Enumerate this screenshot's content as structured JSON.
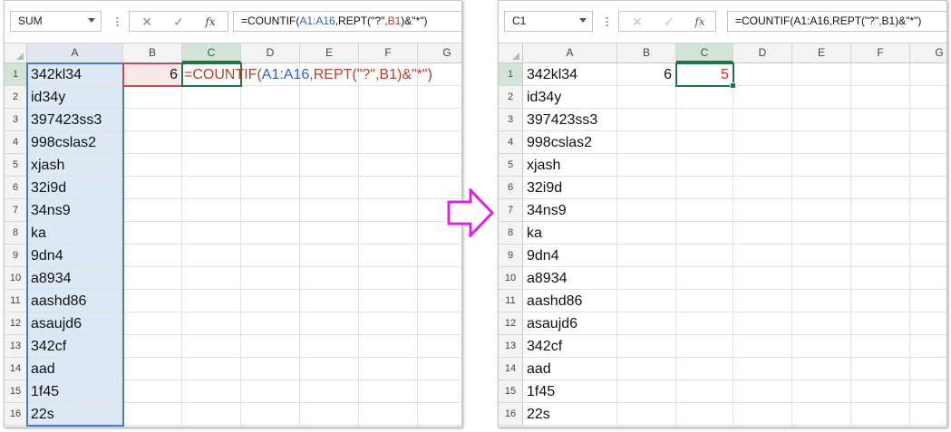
{
  "left": {
    "name_box": "SUM",
    "fx_label": "fx",
    "formula_parts": [
      "=COUNTIF(",
      "A1:A16",
      ",REPT(\"?\",",
      "B1",
      ")&\"*\")"
    ],
    "columns": [
      "A",
      "B",
      "C",
      "D",
      "E",
      "F",
      "G"
    ],
    "b1_value": "6",
    "c1_parts": [
      "=COUNTIF(",
      "A1:A16",
      ",REPT(\"?\",",
      "B1",
      ")&\"*\")"
    ]
  },
  "right": {
    "name_box": "C1",
    "fx_label": "fx",
    "formula": "=COUNTIF(A1:A16,REPT(\"?\",B1)&\"*\")",
    "columns": [
      "A",
      "B",
      "C",
      "D",
      "E",
      "F",
      "G"
    ],
    "b1_value": "6",
    "c1_value": "5"
  },
  "rows": [
    {
      "n": "1",
      "a": "342kl34"
    },
    {
      "n": "2",
      "a": "id34y"
    },
    {
      "n": "3",
      "a": "397423ss3"
    },
    {
      "n": "4",
      "a": "998cslas2"
    },
    {
      "n": "5",
      "a": "xjash"
    },
    {
      "n": "6",
      "a": "32i9d"
    },
    {
      "n": "7",
      "a": "34ns9"
    },
    {
      "n": "8",
      "a": "ka"
    },
    {
      "n": "9",
      "a": "9dn4"
    },
    {
      "n": "10",
      "a": "a8934"
    },
    {
      "n": "11",
      "a": "aashd86"
    },
    {
      "n": "12",
      "a": "asaujd6"
    },
    {
      "n": "13",
      "a": "342cf"
    },
    {
      "n": "14",
      "a": "aad"
    },
    {
      "n": "15",
      "a": "1f45"
    },
    {
      "n": "16",
      "a": "22s"
    }
  ],
  "icons": {
    "cancel": "✕",
    "enter": "✓",
    "arrow": "right-arrow-icon"
  },
  "colors": {
    "accent": "#217346",
    "arrow": "#e020e0",
    "range_blue": "#4a7bd1",
    "ref_red": "#c94b54"
  }
}
